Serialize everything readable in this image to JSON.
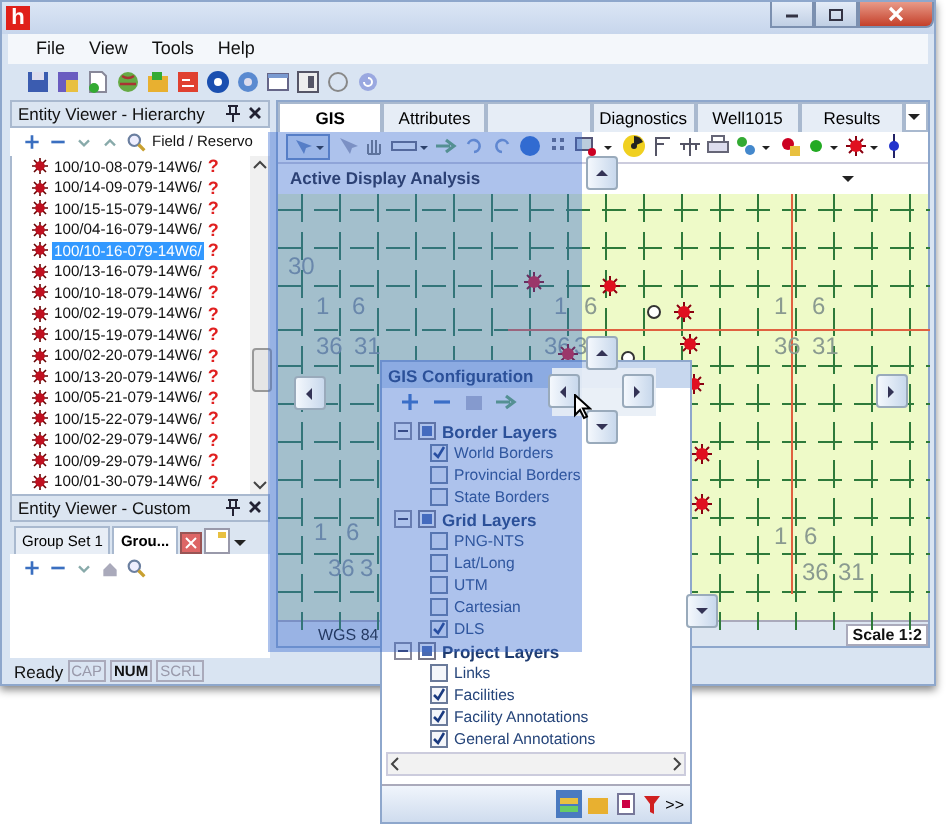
{
  "window": {
    "app_letter": "h"
  },
  "menu": [
    "File",
    "View",
    "Tools",
    "Help"
  ],
  "hierarchy": {
    "title": "Entity Viewer - Hierarchy",
    "filter": "Field / Reservo",
    "wells": [
      {
        "name": "100/10-08-079-14W6/",
        "flag": "?",
        "selected": false
      },
      {
        "name": "100/14-09-079-14W6/",
        "flag": "?",
        "selected": false
      },
      {
        "name": "100/15-15-079-14W6/",
        "flag": "?",
        "selected": false
      },
      {
        "name": "100/04-16-079-14W6/",
        "flag": "?",
        "selected": false
      },
      {
        "name": "100/10-16-079-14W6/",
        "flag": "?",
        "selected": true
      },
      {
        "name": "100/13-16-079-14W6/",
        "flag": "?",
        "selected": false
      },
      {
        "name": "100/10-18-079-14W6/",
        "flag": "?",
        "selected": false
      },
      {
        "name": "100/02-19-079-14W6/",
        "flag": "?",
        "selected": false
      },
      {
        "name": "100/15-19-079-14W6/",
        "flag": "?",
        "selected": false
      },
      {
        "name": "100/02-20-079-14W6/",
        "flag": "?",
        "selected": false
      },
      {
        "name": "100/13-20-079-14W6/",
        "flag": "?",
        "selected": false
      },
      {
        "name": "100/05-21-079-14W6/",
        "flag": "?",
        "selected": false
      },
      {
        "name": "100/15-22-079-14W6/",
        "flag": "?",
        "selected": false
      },
      {
        "name": "100/02-29-079-14W6/",
        "flag": "?",
        "selected": false
      },
      {
        "name": "100/09-29-079-14W6/",
        "flag": "?",
        "selected": false
      },
      {
        "name": "100/01-30-079-14W6/",
        "flag": "?",
        "selected": false
      }
    ]
  },
  "custom": {
    "title": "Entity Viewer - Custom",
    "tabs": [
      {
        "label": "Group Set 1",
        "selected": false
      },
      {
        "label": "Grou...",
        "selected": true
      }
    ]
  },
  "tabs": [
    {
      "label": "GIS",
      "selected": true
    },
    {
      "label": "Attributes",
      "selected": false
    },
    {
      "selected": false
    },
    {
      "label": "Diagnostics",
      "selected": false
    },
    {
      "label": "Well1015",
      "selected": false
    },
    {
      "label": "Results",
      "selected": false
    }
  ],
  "map": {
    "title": "Active Display Analysis",
    "labels": [
      "30",
      "1",
      "6",
      "36",
      "31",
      "1",
      "6",
      "36",
      "3",
      "1",
      "6",
      "36",
      "31",
      "1",
      "6",
      "36",
      "3",
      "1",
      "6",
      "36",
      "31"
    ],
    "crs": "WGS 84",
    "scale": "Scale 1:2"
  },
  "gis_config": {
    "title": "GIS Configuration",
    "more": ">>",
    "groups": [
      {
        "label": "Border Layers",
        "expanded": true,
        "children": [
          {
            "label": "World Borders",
            "checked": true
          },
          {
            "label": "Provincial Borders",
            "checked": false
          },
          {
            "label": "State Borders",
            "checked": false
          }
        ]
      },
      {
        "label": "Grid Layers",
        "expanded": true,
        "children": [
          {
            "label": "PNG-NTS",
            "checked": false
          },
          {
            "label": "Lat/Long",
            "checked": false
          },
          {
            "label": "UTM",
            "checked": false
          },
          {
            "label": "Cartesian",
            "checked": false
          },
          {
            "label": "DLS",
            "checked": true
          }
        ]
      },
      {
        "label": "Project Layers",
        "expanded": true,
        "children": [
          {
            "label": "Links",
            "checked": false
          },
          {
            "label": "Facilities",
            "checked": true
          },
          {
            "label": "Facility Annotations",
            "checked": true
          },
          {
            "label": "General Annotations",
            "checked": true
          }
        ]
      }
    ]
  },
  "status": {
    "text": "Ready",
    "indicators": [
      {
        "label": "CAP",
        "on": false
      },
      {
        "label": "NUM",
        "on": true
      },
      {
        "label": "SCRL",
        "on": false
      }
    ]
  }
}
